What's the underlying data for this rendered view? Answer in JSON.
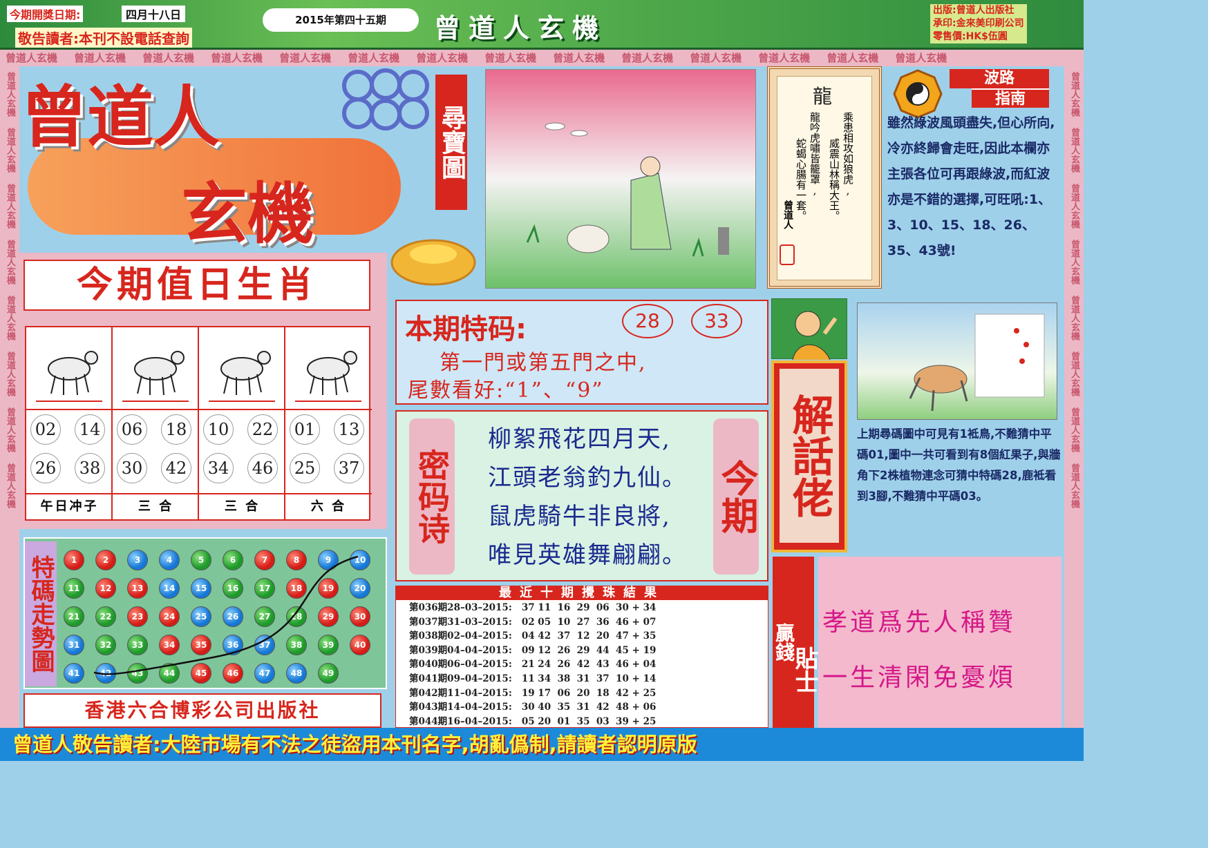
{
  "header": {
    "draw_date_label": "今期開獎日期:",
    "draw_date": "四月十八日",
    "notice": "敬告讀者:本刊不設電話查詢",
    "issue": "2015年第四十五期",
    "paper_title": "曾道人玄機",
    "publisher_line": "出版:曾道人出版社",
    "printer_line": "承印:金來美印刷公司",
    "price_line": "零售價:HK$伍圓",
    "band_text": "曾道人玄機"
  },
  "masthead": {
    "title_1": "曾道人",
    "title_2": "玄機",
    "treasure_label": "尋寶圖"
  },
  "zodiac": {
    "heading": "今期值日生肖",
    "cells": [
      {
        "animal_icon": "horse-icon",
        "nums": [
          "02",
          "14",
          "26",
          "38"
        ],
        "label": "午日冲子"
      },
      {
        "animal_icon": "tiger-icon",
        "nums": [
          "06",
          "18",
          "30",
          "42"
        ],
        "label": "三 合"
      },
      {
        "animal_icon": "dog-icon",
        "nums": [
          "10",
          "22",
          "34",
          "46"
        ],
        "label": "三 合"
      },
      {
        "animal_icon": "sheep-icon",
        "nums": [
          "01",
          "13",
          "25",
          "37"
        ],
        "label": "六 合"
      }
    ]
  },
  "trend": {
    "title": "特碼走勢圖",
    "balls": [
      {
        "n": "1",
        "c": "r"
      },
      {
        "n": "2",
        "c": "r"
      },
      {
        "n": "3",
        "c": "b"
      },
      {
        "n": "4",
        "c": "b"
      },
      {
        "n": "5",
        "c": "g"
      },
      {
        "n": "6",
        "c": "g"
      },
      {
        "n": "7",
        "c": "r"
      },
      {
        "n": "8",
        "c": "r"
      },
      {
        "n": "9",
        "c": "b"
      },
      {
        "n": "10",
        "c": "b"
      },
      {
        "n": "11",
        "c": "g"
      },
      {
        "n": "12",
        "c": "r"
      },
      {
        "n": "13",
        "c": "r"
      },
      {
        "n": "14",
        "c": "b"
      },
      {
        "n": "15",
        "c": "b"
      },
      {
        "n": "16",
        "c": "g"
      },
      {
        "n": "17",
        "c": "g"
      },
      {
        "n": "18",
        "c": "r"
      },
      {
        "n": "19",
        "c": "r"
      },
      {
        "n": "20",
        "c": "b"
      },
      {
        "n": "21",
        "c": "g"
      },
      {
        "n": "22",
        "c": "g"
      },
      {
        "n": "23",
        "c": "r"
      },
      {
        "n": "24",
        "c": "r"
      },
      {
        "n": "25",
        "c": "b"
      },
      {
        "n": "26",
        "c": "b"
      },
      {
        "n": "27",
        "c": "g"
      },
      {
        "n": "28",
        "c": "g"
      },
      {
        "n": "29",
        "c": "r"
      },
      {
        "n": "30",
        "c": "r"
      },
      {
        "n": "31",
        "c": "b"
      },
      {
        "n": "32",
        "c": "g"
      },
      {
        "n": "33",
        "c": "g"
      },
      {
        "n": "34",
        "c": "r"
      },
      {
        "n": "35",
        "c": "r"
      },
      {
        "n": "36",
        "c": "b"
      },
      {
        "n": "37",
        "c": "b"
      },
      {
        "n": "38",
        "c": "g"
      },
      {
        "n": "39",
        "c": "g"
      },
      {
        "n": "40",
        "c": "r"
      },
      {
        "n": "41",
        "c": "b"
      },
      {
        "n": "42",
        "c": "b"
      },
      {
        "n": "43",
        "c": "g"
      },
      {
        "n": "44",
        "c": "g"
      },
      {
        "n": "45",
        "c": "r"
      },
      {
        "n": "46",
        "c": "r"
      },
      {
        "n": "47",
        "c": "b"
      },
      {
        "n": "48",
        "c": "b"
      },
      {
        "n": "49",
        "c": "g"
      }
    ],
    "publisher": "香港六合博彩公司出版社"
  },
  "special": {
    "heading": "本期特码:",
    "numbers": [
      "28",
      "33"
    ],
    "line1": "第一門或第五門之中,",
    "line2": "尾數看好:“1”、“9”"
  },
  "poem": {
    "left_label": "密码诗",
    "right_label": "今期",
    "lines": [
      "柳絮飛花四月天,",
      "江頭老翁釣九仙。",
      "鼠虎騎牛非良將,",
      "唯見英雄舞翩翩。"
    ]
  },
  "draws": {
    "heading": "最近十期攪珠結果",
    "rows": [
      {
        "label": "第036期28–03–2015:",
        "nums": "37 11  16  29  06  30",
        "sp": "34"
      },
      {
        "label": "第037期31–03–2015:",
        "nums": "02 05  10  27  36  46",
        "sp": "07"
      },
      {
        "label": "第038期02–04–2015:",
        "nums": "04 42  37  12  20  47",
        "sp": "35"
      },
      {
        "label": "第039期04–04–2015:",
        "nums": "09 12  26  29  44  45",
        "sp": "19"
      },
      {
        "label": "第040期06–04–2015:",
        "nums": "21 24  26  42  43  46",
        "sp": "04"
      },
      {
        "label": "第041期09–04–2015:",
        "nums": "11 34  38  31  37  10",
        "sp": "14"
      },
      {
        "label": "第042期11–04–2015:",
        "nums": "19 17  06  20  18  42",
        "sp": "25"
      },
      {
        "label": "第043期14–04–2015:",
        "nums": "30 40  35  31  42  48",
        "sp": "06"
      },
      {
        "label": "第044期16–04–2015:",
        "nums": "05 20  01  35  03  39",
        "sp": "25"
      }
    ]
  },
  "scroll": {
    "title": "龍",
    "col1": "乘患相攻如狼虎,",
    "col2": "威震山林稱大王。",
    "col3": "龍吟虎嘯皆籠罩,",
    "col4": "蛇蝎心腸有一套。",
    "signature": "曾道人"
  },
  "wave": {
    "title_1": "波路",
    "title_2": "指南",
    "text": "雖然綠波風頭盡失,但心所向,冷亦終歸會走旺,因此本欄亦主張各位可再跟綠波,而紅波亦是不錯的選擇,可旺吼:1、3、10、15、18、26、35、43號!"
  },
  "explain": {
    "label": "解話佬",
    "text": "上期尋碼圖中可見有1袛鳥,不難猜中平碼01,圖中一共可看到有8個紅果子,與牆角下2株植物連念可猜中特碼28,鹿袛看到3腳,不難猜中平碼03。"
  },
  "tips": {
    "label_1": "贏錢",
    "label_2": "貼士",
    "line1": "孝道爲先人稱贊",
    "line2": "一生清閑免憂煩"
  },
  "footer": {
    "warning": "曾道人敬告讀者:大陸市場有不法之徒盜用本刊名字,胡亂僞制,請讀者認明原版"
  },
  "colors": {
    "red": "#d7261d",
    "green": "#2d8a3c",
    "pink": "#ecb8c6",
    "blue": "#1c8ad8",
    "yellow": "#fff23a"
  }
}
